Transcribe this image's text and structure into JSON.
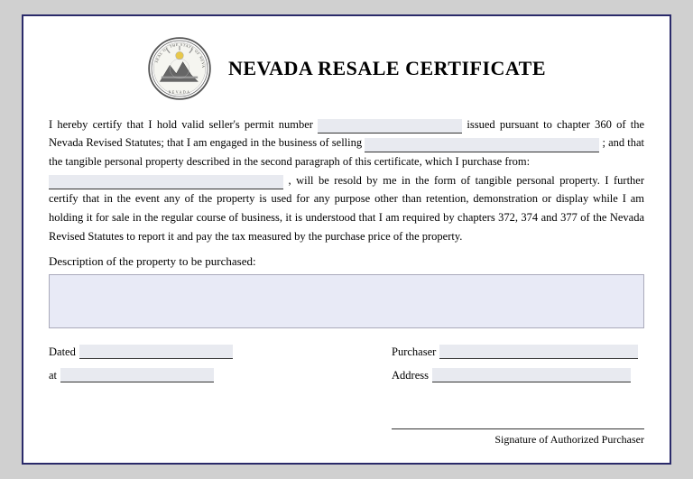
{
  "certificate": {
    "title": "NEVADA RESALE CERTIFICATE",
    "body1": "I hereby certify that I hold valid seller's permit number",
    "body2": "issued pursuant to chapter 360 of the Nevada Revised Statutes; that I am engaged in the business of selling",
    "body3": "; and that the tangible personal property described in the second paragraph of this certificate, which I purchase from:",
    "body4": ", will be resold by me in the form of tangible personal property. I further certify that in the event any of the property is used for any purpose other than retention, demonstration or display while I am holding it for sale in the regular course of business, it is understood that I am required by chapters 372, 374 and 377 of the Nevada Revised Statutes to report it and pay the tax measured by the purchase price of the property.",
    "description_label": "Description of the property to be purchased:",
    "dated_label": "Dated",
    "at_label": "at",
    "purchaser_label": "Purchaser",
    "address_label": "Address",
    "signature_label": "Signature of Authorized Purchaser"
  }
}
